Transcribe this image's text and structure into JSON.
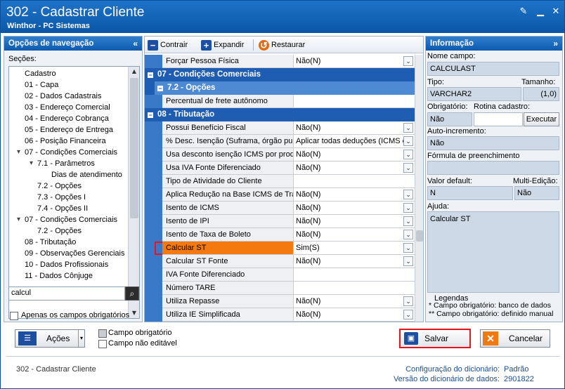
{
  "window": {
    "title": "302 - Cadastrar Cliente",
    "subtitle": "Winthor - PC Sistemas"
  },
  "left_panel": {
    "title": "Opções de navegação",
    "sections_label": "Seções:",
    "tree": [
      {
        "label": "Cadastro",
        "indent": 0
      },
      {
        "label": "01 - Capa",
        "indent": 0
      },
      {
        "label": "02 - Dados Cadastrais",
        "indent": 0
      },
      {
        "label": "03 - Endereço Comercial",
        "indent": 0
      },
      {
        "label": "04 - Endereço Cobrança",
        "indent": 0
      },
      {
        "label": "05 - Endereço de Entrega",
        "indent": 0
      },
      {
        "label": "06 - Posição Financeira",
        "indent": 0
      },
      {
        "label": "07 - Condições Comerciais",
        "indent": 0,
        "expander": "▾"
      },
      {
        "label": "7.1 - Parâmetros",
        "indent": 1,
        "expander": "▾"
      },
      {
        "label": "Dias de atendimento",
        "indent": 2
      },
      {
        "label": "7.2 - Opções",
        "indent": 1
      },
      {
        "label": "7.3 - Opções I",
        "indent": 1
      },
      {
        "label": "7.4 - Opções II",
        "indent": 1
      },
      {
        "label": "07 - Condições Comerciais",
        "indent": 0,
        "expander": "▾"
      },
      {
        "label": "7.2 - Opções",
        "indent": 1
      },
      {
        "label": "08 - Tributação",
        "indent": 0
      },
      {
        "label": "09 - Observações Gerenciais",
        "indent": 0
      },
      {
        "label": "10 - Dados Profissionais",
        "indent": 0
      },
      {
        "label": "11 - Dados Cônjuge",
        "indent": 0
      }
    ],
    "search_value": "calcul",
    "only_required_label": "Apenas os campos obrigatórios"
  },
  "toolbar": {
    "collapse_label": "Contrair",
    "expand_label": "Expandir",
    "restore_label": "Restaurar"
  },
  "grid": {
    "rows": [
      {
        "type": "field",
        "name": "Forçar Pessoa Física",
        "value": "Não(N)",
        "dropdown": true
      },
      {
        "type": "category",
        "name": "07 - Condições Comerciais"
      },
      {
        "type": "subcategory",
        "name": "7.2 - Opções"
      },
      {
        "type": "field",
        "name": "Percentual de frete autônomo",
        "value": "",
        "dropdown": false
      },
      {
        "type": "category",
        "name": "08 - Tributação"
      },
      {
        "type": "field",
        "name": "Possui Benefício Fiscal",
        "value": "Não(N)",
        "dropdown": true
      },
      {
        "type": "field",
        "name": "% Desc. Isenção (Suframa, órgão pu",
        "value": "Aplicar todas deduções (ICMS e",
        "dropdown": true
      },
      {
        "type": "field",
        "name": "Usa desconto isenção ICMS por produ",
        "value": "Não(N)",
        "dropdown": true
      },
      {
        "type": "field",
        "name": "Usa IVA Fonte Diferenciado",
        "value": "Não(N)",
        "dropdown": true
      },
      {
        "type": "field",
        "name": "Tipo de Atividade do Cliente",
        "value": "",
        "dropdown": false
      },
      {
        "type": "field",
        "name": "Aplica Redução na Base ICMS de Trar",
        "value": "Não(N)",
        "dropdown": true
      },
      {
        "type": "field",
        "name": "Isento de ICMS",
        "value": "Não(N)",
        "dropdown": true
      },
      {
        "type": "field",
        "name": "Isento de IPI",
        "value": "Não(N)",
        "dropdown": true
      },
      {
        "type": "field",
        "name": "Isento de Taxa de Boleto",
        "value": "Não(N)",
        "dropdown": true
      },
      {
        "type": "field",
        "name": "Calcular ST",
        "value": "Sim(S)",
        "dropdown": true,
        "selected": true
      },
      {
        "type": "field",
        "name": "Calcular ST Fonte",
        "value": "Não(N)",
        "dropdown": true
      },
      {
        "type": "field",
        "name": "IVA Fonte Diferenciado",
        "value": "",
        "dropdown": false
      },
      {
        "type": "field",
        "name": "Número TARE",
        "value": "",
        "dropdown": false
      },
      {
        "type": "field",
        "name": "Utiliza Repasse",
        "value": "Não(N)",
        "dropdown": true
      },
      {
        "type": "field",
        "name": "Utiliza IE Simplificada",
        "value": "Não(N)",
        "dropdown": true
      }
    ]
  },
  "info_panel": {
    "title": "Informação",
    "field_name_label": "Nome campo:",
    "field_name_value": "CALCULAST",
    "type_label": "Tipo:",
    "type_value": "VARCHAR2",
    "size_label": "Tamanho:",
    "size_value": "(1,0)",
    "required_label": "Obrigatório:",
    "required_value": "Não",
    "routine_label": "Rotina cadastro:",
    "execute_label": "Executar",
    "autoinc_label": "Auto-incremento:",
    "autoinc_value": "Não",
    "formula_label": "Fórmula de preenchimento",
    "formula_value": "",
    "default_label": "Valor default:",
    "default_value": "N",
    "multiedit_label": "Multi-Edição:",
    "multiedit_value": "Não",
    "help_label": "Ajuda:",
    "help_value": "Calcular ST",
    "legend_title": "Legendas",
    "legend_1": "* Campo obrigatório: banco de dados",
    "legend_2": "** Campo obrigatório: definido manual"
  },
  "footer": {
    "actions_label": "Ações",
    "legend_required": "Campo obrigatório",
    "legend_readonly": "Campo não editável",
    "save_label": "Salvar",
    "cancel_label": "Cancelar"
  },
  "status": {
    "left": "302 - Cadastrar Cliente",
    "dict_config_label": "Configuração do dicionário:",
    "dict_config_value": "Padrão",
    "dict_version_label": "Versão do dicionário de dados:",
    "dict_version_value": "2901822"
  },
  "colors": {
    "title_bar": "#0a57a8",
    "category_row": "#1e5db2",
    "selected_row": "#f47a10",
    "highlight_border": "#e8141c"
  }
}
